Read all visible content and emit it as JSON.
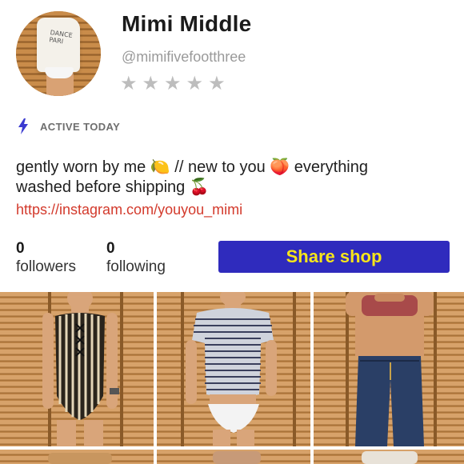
{
  "profile": {
    "name": "Mimi Middle",
    "handle": "@mimifivefootthree",
    "rating_stars": 5,
    "rating_filled": 0,
    "avatar_shirt_text": "DANCE\nPARI",
    "activity": "ACTIVE TODAY",
    "bio_line1": "gently worn by me 🍋 // new to you 🍑 everything",
    "bio_line2": "washed before shipping 🍒",
    "link": "https://instagram.com/youyou_mimi"
  },
  "stats": {
    "followers_count": "0",
    "followers_label": "followers",
    "following_count": "0",
    "following_label": "following"
  },
  "actions": {
    "share_label": "Share shop"
  },
  "colors": {
    "accent_button": "#2f2bbd",
    "button_text": "#f7e51a",
    "link": "#d33a2c",
    "bolt": "#3a3ad0"
  },
  "listings": [
    {
      "name": "striped-lace-up-bodysuit"
    },
    {
      "name": "striped-tee-and-white-brief"
    },
    {
      "name": "bra-and-jeans"
    },
    {
      "name": "listing-4"
    },
    {
      "name": "listing-5"
    },
    {
      "name": "listing-6"
    }
  ]
}
